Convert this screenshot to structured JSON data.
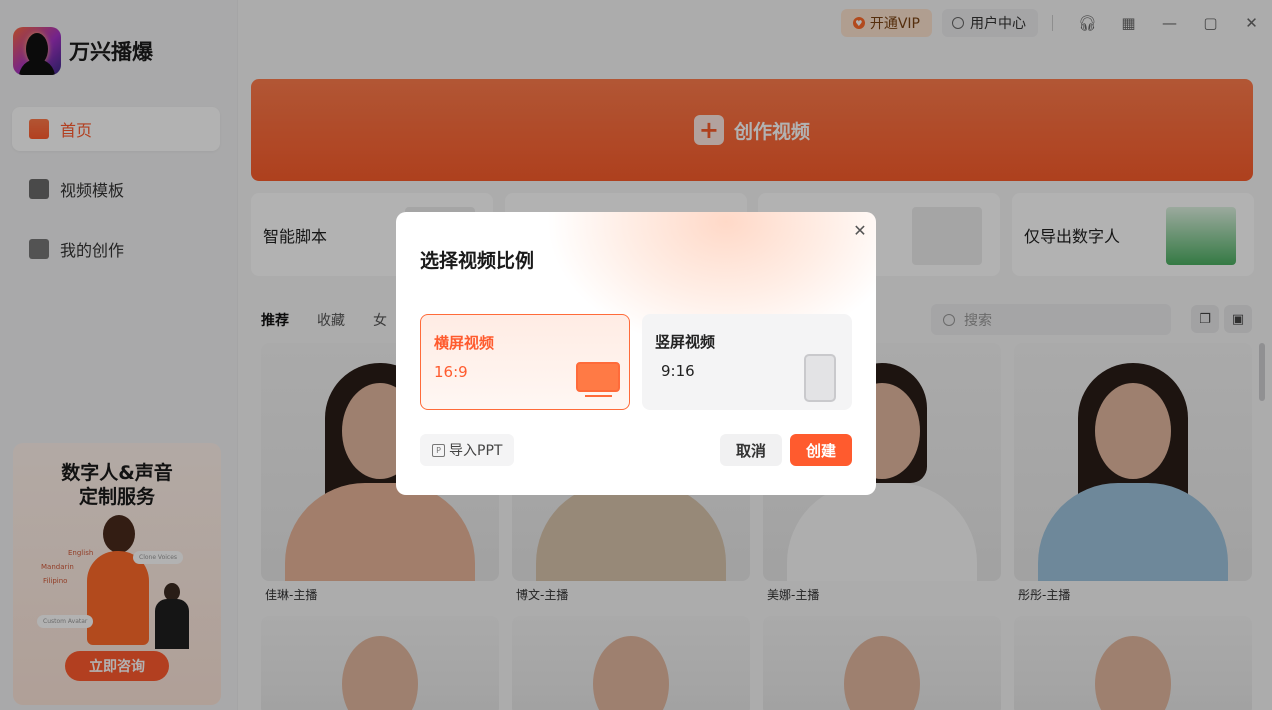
{
  "app": {
    "name": "万兴播爆"
  },
  "titlebar": {
    "vip_label": "开通VIP",
    "user_label": "用户中心"
  },
  "sidebar": {
    "items": [
      {
        "label": "首页",
        "active": true
      },
      {
        "label": "视频模板",
        "active": false
      },
      {
        "label": "我的创作",
        "active": false
      }
    ],
    "promo": {
      "title_line1": "数字人&声音",
      "title_line2": "定制服务",
      "languages": [
        "English",
        "Mandarin",
        "Filipino"
      ],
      "tag_clone_voices": "Clone Voices",
      "tag_custom_avatar": "Custom Avatar",
      "button": "立即咨询"
    }
  },
  "main": {
    "create_label": "创作视频",
    "features": [
      {
        "label": "智能脚本"
      },
      {
        "label": ""
      },
      {
        "label": ""
      },
      {
        "label": "仅导出数字人"
      }
    ],
    "tabs": [
      {
        "label": "推荐",
        "active": true
      },
      {
        "label": "收藏",
        "active": false
      },
      {
        "label": "女",
        "active": false
      }
    ],
    "search_placeholder": "搜索",
    "avatars": [
      {
        "name": "佳琳-主播"
      },
      {
        "name": "博文-主播"
      },
      {
        "name": "美娜-主播"
      },
      {
        "name": "彤彤-主播"
      }
    ]
  },
  "modal": {
    "title": "选择视频比例",
    "options": [
      {
        "title": "横屏视频",
        "ratio": "16:9",
        "selected": true
      },
      {
        "title": "竖屏视频",
        "ratio": "9:16",
        "selected": false
      }
    ],
    "import_ppt_label": "导入PPT",
    "cancel_label": "取消",
    "create_label": "创建"
  },
  "colors": {
    "accent": "#ff5b2e",
    "vip_bg": "#fde3cf",
    "overlay": "rgba(0,0,0,0.3)"
  }
}
